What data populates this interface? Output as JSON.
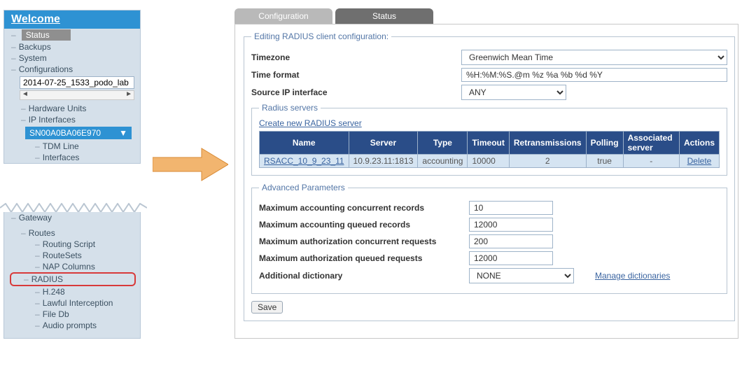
{
  "sidebar": {
    "welcome": "Welcome",
    "status": "Status",
    "backups": "Backups",
    "system": "System",
    "configurations": "Configurations",
    "config_name": "2014-07-25_1533_podo_lab",
    "hardware_units": "Hardware Units",
    "ip_interfaces": "IP Interfaces",
    "device_id": "SN00A0BA06E970",
    "tdm_line": "TDM Line",
    "interfaces": "Interfaces",
    "gateway": "Gateway",
    "routes": "Routes",
    "routing_script": "Routing Script",
    "route_sets": "RouteSets",
    "nap_columns": "NAP Columns",
    "radius": "RADIUS",
    "h248": "H.248",
    "lawful": "Lawful Interception",
    "filedb": "File Db",
    "audio": "Audio prompts"
  },
  "tabs": {
    "configuration": "Configuration",
    "status": "Status"
  },
  "edit": {
    "legend": "Editing RADIUS client configuration:",
    "timezone_label": "Timezone",
    "timezone_value": "Greenwich Mean Time",
    "timeformat_label": "Time format",
    "timeformat_value": "%H:%M:%S.@m %z %a %b %d %Y",
    "sourceip_label": "Source IP interface",
    "sourceip_value": "ANY"
  },
  "servers": {
    "legend": "Radius servers",
    "create_link": "Create new RADIUS server",
    "headers": {
      "name": "Name",
      "server": "Server",
      "type": "Type",
      "timeout": "Timeout",
      "retrans": "Retransmissions",
      "polling": "Polling",
      "assoc": "Associated server",
      "actions": "Actions"
    },
    "row": {
      "name": "RSACC_10_9_23_11",
      "server": "10.9.23.11:1813",
      "type": "accounting",
      "timeout": "10000",
      "retrans": "2",
      "polling": "true",
      "assoc": "-",
      "delete": "Delete"
    }
  },
  "adv": {
    "legend": "Advanced Parameters",
    "max_acc_conc_label": "Maximum accounting concurrent records",
    "max_acc_conc": "10",
    "max_acc_q_label": "Maximum accounting queued records",
    "max_acc_q": "12000",
    "max_auth_conc_label": "Maximum authorization concurrent requests",
    "max_auth_conc": "200",
    "max_auth_q_label": "Maximum authorization queued requests",
    "max_auth_q": "12000",
    "dict_label": "Additional dictionary",
    "dict_value": "NONE",
    "manage_link": "Manage dictionaries"
  },
  "save": "Save"
}
